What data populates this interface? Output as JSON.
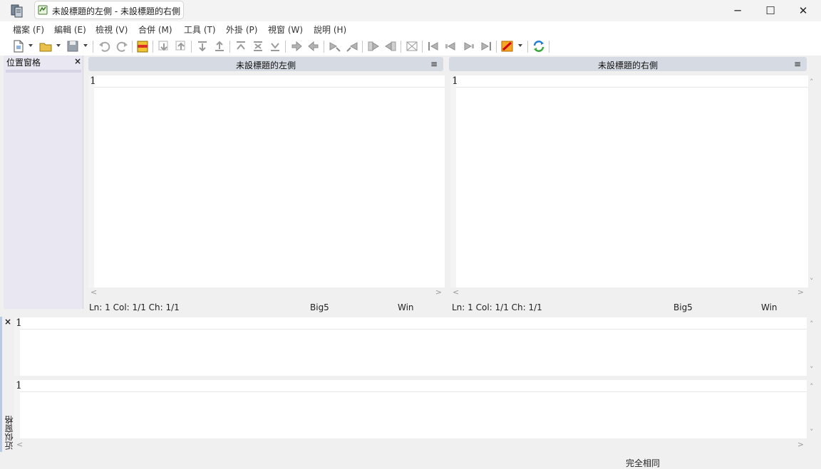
{
  "window": {
    "title": "未設標題的左側 - 未設標題的右側",
    "minimize_glyph": "─",
    "maximize_glyph": "☐",
    "close_glyph": "✕"
  },
  "menu": [
    {
      "label": "檔案 (F)"
    },
    {
      "label": "編輯 (E)"
    },
    {
      "label": "檢視 (V)"
    },
    {
      "label": "合併 (M)"
    },
    {
      "label": "工具 (T)"
    },
    {
      "label": "外掛 (P)"
    },
    {
      "label": "視窗 (W)"
    },
    {
      "label": "說明 (H)"
    }
  ],
  "location_pane": {
    "title": "位置窗格",
    "close": "×"
  },
  "left_pane": {
    "title": "未設標題的左側",
    "menu_glyph": "≡",
    "line_number": "1",
    "status": {
      "position": "Ln: 1  Col: 1/1  Ch: 1/1",
      "encoding": "Big5",
      "eol": "Win"
    }
  },
  "right_pane": {
    "title": "未設標題的右側",
    "menu_glyph": "≡",
    "line_number": "1",
    "status": {
      "position": "Ln: 1  Col: 1/1  Ch: 1/1",
      "encoding": "Big5",
      "eol": "Win"
    }
  },
  "diff_pane": {
    "close": "×",
    "label": "近似窗格",
    "top_line_number": "1",
    "bottom_line_number": "1"
  },
  "statusbar": {
    "message": "完全相同"
  },
  "colors": {
    "pane_header": "#d6dbe3",
    "location_pane_bg": "#e9e8f2",
    "sync_icon": "#1f7fd6"
  },
  "toolbar_icons": [
    "new-icon",
    "open-icon",
    "save-icon",
    "undo-icon",
    "redo-icon",
    "options-icon",
    "next-diff-icon",
    "prev-diff-icon",
    "copy-right-icon",
    "copy-left-icon",
    "first-diff-icon",
    "last-diff-icon",
    "all-right-icon",
    "all-left-icon",
    "refresh-icon"
  ]
}
